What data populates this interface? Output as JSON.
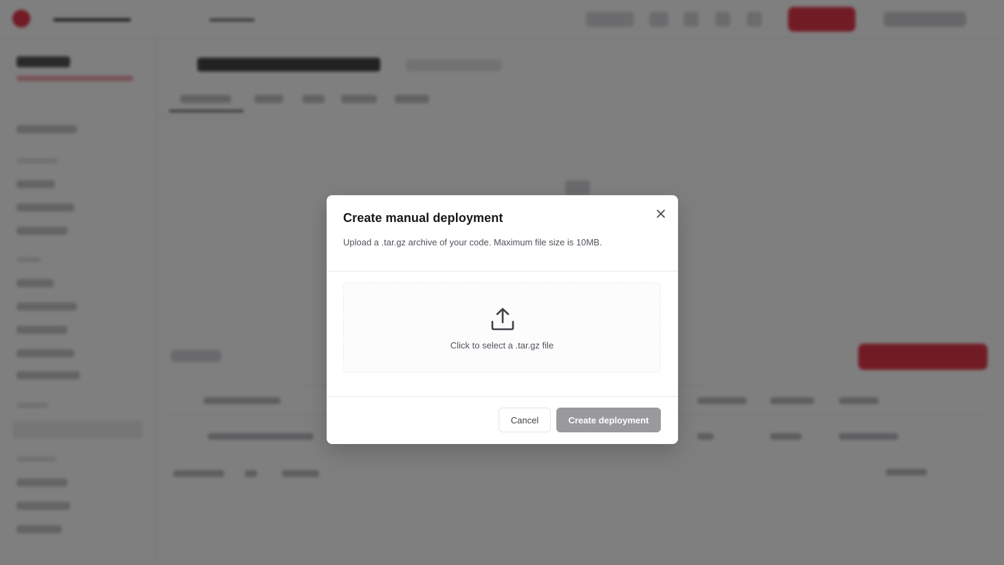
{
  "dialog": {
    "title": "Create manual deployment",
    "description": "Upload a .tar.gz archive of your code. Maximum file size is 10MB.",
    "dropzone": {
      "label": "Click to select a .tar.gz file",
      "icon": "upload-icon"
    },
    "close_icon": "close-icon",
    "buttons": {
      "cancel": "Cancel",
      "create": "Create deployment"
    }
  },
  "colors": {
    "overlay": "rgba(0,0,0,0.5)",
    "accent": "#e3374b",
    "primary_button_disabled": "#9a999d"
  }
}
